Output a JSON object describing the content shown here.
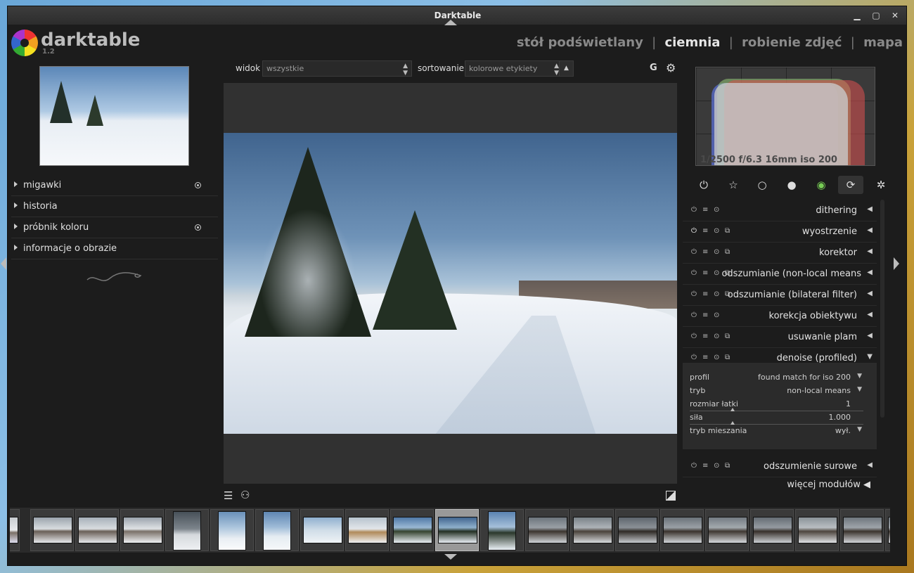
{
  "window": {
    "title": "Darktable"
  },
  "app": {
    "name": "darktable",
    "version": "1.2"
  },
  "views": [
    {
      "label": "stół podświetlany",
      "active": false
    },
    {
      "label": "ciemnia",
      "active": true
    },
    {
      "label": "robienie zdjęć",
      "active": false
    },
    {
      "label": "mapa",
      "active": false
    }
  ],
  "view_separator": "|",
  "left_panel": {
    "items": [
      {
        "label": "migawki",
        "has_reset": true
      },
      {
        "label": "historia",
        "has_reset": false
      },
      {
        "label": "próbnik koloru",
        "has_reset": true
      },
      {
        "label": "informacje o obrazie",
        "has_reset": false
      }
    ]
  },
  "toolbar": {
    "view_label": "widok",
    "view_value": "wszystkie",
    "sort_label": "sortowanie",
    "sort_value": "kolorowe etykiety",
    "sort_dir": "▲",
    "grouping": "G"
  },
  "histogram": {
    "exif": "1/2500 f/6.3 16mm iso 200"
  },
  "module_groups": [
    {
      "icon": "power-icon",
      "glyph": "⏻"
    },
    {
      "icon": "star-icon",
      "glyph": "☆"
    },
    {
      "icon": "circle-icon",
      "glyph": "○"
    },
    {
      "icon": "sphere-icon",
      "glyph": "●"
    },
    {
      "icon": "color-wheel-icon",
      "glyph": "◉"
    },
    {
      "icon": "correct-icon",
      "glyph": "⟳",
      "active": true
    },
    {
      "icon": "effect-icon",
      "glyph": "✲"
    }
  ],
  "modules": [
    {
      "name": "dithering",
      "arrow": "◀"
    },
    {
      "name": "wyostrzenie",
      "arrow": "◀"
    },
    {
      "name": "korektor",
      "arrow": "◀"
    },
    {
      "name": "odszumianie (non-local means",
      "arrow": "◀"
    },
    {
      "name": "odszumianie (bilateral filter)",
      "arrow": "◀"
    },
    {
      "name": "korekcja obiektywu",
      "arrow": "◀"
    },
    {
      "name": "usuwanie plam",
      "arrow": "◀"
    },
    {
      "name": "denoise (profiled)",
      "arrow": "▼"
    },
    {
      "name": "odszumienie surowe",
      "arrow": "◀"
    }
  ],
  "denoise_params": [
    {
      "label": "profil",
      "value": "found match for iso 200",
      "dropdown": "▼"
    },
    {
      "label": "tryb",
      "value": "non-local means",
      "dropdown": "▼"
    },
    {
      "label": "rozmiar łatki",
      "value": "1",
      "dropdown": ""
    },
    {
      "label": "siła",
      "value": "1.000",
      "dropdown": ""
    },
    {
      "label": "tryb mieszania",
      "value": "wył.",
      "dropdown": "▼"
    }
  ],
  "more_modules": "więcej modułów ◀"
}
